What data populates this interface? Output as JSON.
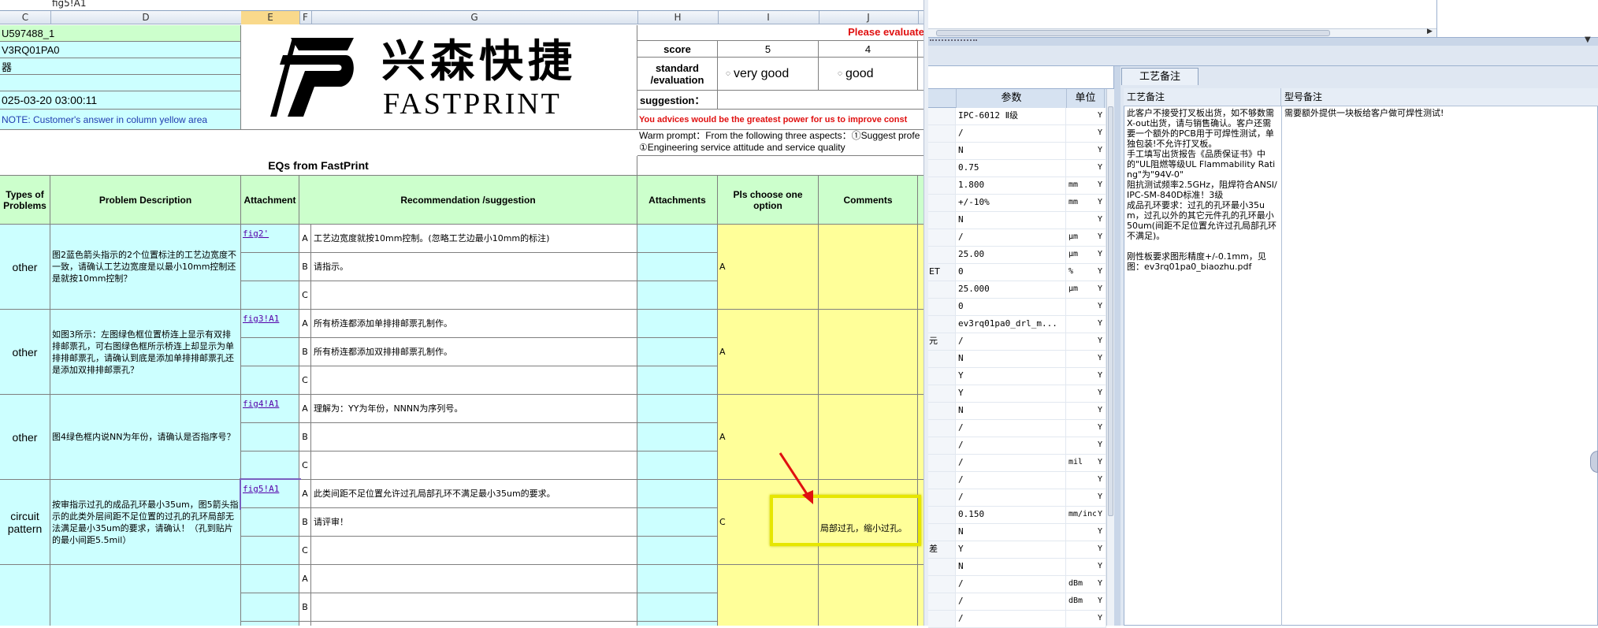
{
  "formula_bar": {
    "value": "fig5!A1"
  },
  "columns": [
    "C",
    "D",
    "E",
    "F",
    "G",
    "H",
    "I",
    "J"
  ],
  "info_rows": [
    "U597488_1",
    "V3RQ01PA0",
    "器",
    "",
    "025-03-20 03:00:11",
    "NOTE: Customer's  answer in column yellow area"
  ],
  "logo": {
    "cn": "兴森快捷",
    "en": "FASTPRINT"
  },
  "evaluation": {
    "banner": "Please evaluate",
    "score_label": "score",
    "score_5": "5",
    "score_4": "4",
    "standard_label": "standard\n/evaluation",
    "opt_5": "very good",
    "opt_4": "good",
    "suggestion_label": "suggestion：",
    "advice": "You advices would be the greatest power for us to improve const",
    "warm1": "Warm prompt：From the following three aspects：①Suggest profe",
    "warm2": "①Engineering service attitude and service quality"
  },
  "eq_title": "EQs from FastPrint",
  "headers": {
    "type": "Types of\nProblems",
    "desc": "Problem Description",
    "attach": "Attachment",
    "rec": "Recommendation /suggestion",
    "attachments": "Attachments",
    "choose": "Pls choose one option",
    "comments": "Comments"
  },
  "eqs": [
    {
      "type": "other",
      "desc": "图2蓝色箭头指示的2个位置标注的工艺边宽度不一致，请确认工艺边宽度是以最小10mm控制还是就按10mm控制？",
      "link": "fig2'",
      "options": [
        "工艺边宽度就按10mm控制。(忽略工艺边最小10mm的标注)",
        "请指示。",
        ""
      ],
      "choice": "A",
      "comment": ""
    },
    {
      "type": "other",
      "desc": "如图3所示：左图绿色框位置桥连上显示有双排排邮票孔，可右图绿色框所示桥连上却显示为单排排邮票孔，请确认到底是添加单排排邮票孔还是添加双排排邮票孔？",
      "link": "fig3!A1",
      "options": [
        "所有桥连都添加单排排邮票孔制作。",
        "所有桥连都添加双排排邮票孔制作。",
        ""
      ],
      "choice": "A",
      "comment": ""
    },
    {
      "type": "other",
      "desc": "图4绿色框内说NN为年份，请确认是否指序号？",
      "link": "fig4!A1",
      "options": [
        "理解为：YY为年份，NNNN为序列号。",
        "",
        ""
      ],
      "choice": "A",
      "comment": ""
    },
    {
      "type": "circuit\npattern",
      "desc": "按审指示过孔的成品孔环最小35um，图5箭头指示的此类外层间距不足位置的过孔的孔环局部无法满足最小35um的要求，请确认！（孔到贴片的最小间距5.5mil）",
      "link": "fig5!A1",
      "options": [
        "此类间距不足位置允许过孔局部孔环不满足最小35um的要求。",
        "请评审！",
        ""
      ],
      "choice": "C",
      "comment": "局部过孔，缩小过孔。"
    },
    {
      "type": "",
      "desc": "",
      "link": "",
      "options": [
        "",
        "",
        ""
      ],
      "choice": "",
      "comment": ""
    }
  ],
  "option_letters": [
    "A",
    "B",
    "C"
  ],
  "right_panel": {
    "tab_process": "工艺备注",
    "col_param": "参数",
    "col_unit": "单位",
    "col_process_note": "工艺备注",
    "col_model_note": "型号备注",
    "process_note": "此客户不接受打叉板出货，如不够数需X-out出货，请与销售确认。客户还需要一个额外的PCB用于可焊性测试，单独包装!不允许打叉板。\n手工填写出货报告《品质保证书》中的\"UL阻燃等级UL Flammability Rating\"为\"94V-0\"\n阻抗测试频率2.5GHz，阻焊符合ANSI/IPC-SM-840D标准！3级\n成品孔环要求：过孔的孔环最小35um，过孔以外的其它元件孔的孔环最小50um(间距不足位置允许过孔局部孔环不满足)。\n\n刚性板要求图形精度+/-0.1mm，见图：ev3rq01pa0_biaozhu.pdf",
    "model_note": "需要额外提供一块板给客户做可焊性测试!",
    "side_labels": [
      "ET",
      "元",
      "差"
    ],
    "rows": [
      {
        "param": "IPC-6012 Ⅱ级",
        "unit": "",
        "flag": "Y"
      },
      {
        "param": "/",
        "unit": "",
        "flag": "Y"
      },
      {
        "param": "N",
        "unit": "",
        "flag": "Y"
      },
      {
        "param": "0.75",
        "unit": "",
        "flag": "Y"
      },
      {
        "param": "1.800",
        "unit": "mm",
        "flag": "Y"
      },
      {
        "param": "+/-10%",
        "unit": "mm",
        "flag": "Y"
      },
      {
        "param": "N",
        "unit": "",
        "flag": "Y"
      },
      {
        "param": "/",
        "unit": "μm",
        "flag": "Y"
      },
      {
        "param": "25.00",
        "unit": "μm",
        "flag": "Y"
      },
      {
        "param": "0",
        "unit": "%",
        "flag": "Y"
      },
      {
        "param": "25.000",
        "unit": "μm",
        "flag": "Y"
      },
      {
        "param": "0",
        "unit": "",
        "flag": "Y"
      },
      {
        "param": "ev3rq01pa0_drl_m...",
        "unit": "",
        "flag": "Y"
      },
      {
        "param": "/",
        "unit": "",
        "flag": "Y"
      },
      {
        "param": "N",
        "unit": "",
        "flag": "Y"
      },
      {
        "param": "Y",
        "unit": "",
        "flag": "Y"
      },
      {
        "param": "Y",
        "unit": "",
        "flag": "Y"
      },
      {
        "param": "N",
        "unit": "",
        "flag": "Y"
      },
      {
        "param": "/",
        "unit": "",
        "flag": "Y"
      },
      {
        "param": "/",
        "unit": "",
        "flag": "Y"
      },
      {
        "param": "/",
        "unit": "mil",
        "flag": "Y"
      },
      {
        "param": "/",
        "unit": "",
        "flag": "Y"
      },
      {
        "param": "/",
        "unit": "",
        "flag": "Y"
      },
      {
        "param": "0.150",
        "unit": "mm/inch",
        "flag": "Y"
      },
      {
        "param": "N",
        "unit": "",
        "flag": "Y"
      },
      {
        "param": "Y",
        "unit": "",
        "flag": "Y"
      },
      {
        "param": "N",
        "unit": "",
        "flag": "Y"
      },
      {
        "param": "/",
        "unit": "dBm",
        "flag": "Y"
      },
      {
        "param": "/",
        "unit": "dBm",
        "flag": "Y"
      },
      {
        "param": "/",
        "unit": "",
        "flag": "Y"
      }
    ]
  },
  "colors": {
    "cyan": "#ccffff",
    "green": "#ccffcc",
    "yellow": "#ffff99",
    "highlight": "#e6e600",
    "arrow": "#e01010"
  }
}
